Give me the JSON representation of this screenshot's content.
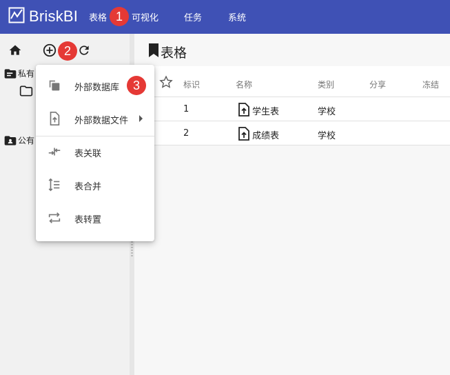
{
  "app": {
    "logo_text": "BriskBI"
  },
  "topnav": {
    "items": [
      {
        "label": "表格"
      },
      {
        "label": "可视化"
      },
      {
        "label": "任务"
      },
      {
        "label": "系统"
      }
    ]
  },
  "annotations": {
    "badge1": "1",
    "badge2": "2",
    "badge3": "3"
  },
  "sidebar": {
    "toolbar": {
      "home_icon": "home-icon",
      "add_icon": "add-circle-icon",
      "refresh_icon": "refresh-icon"
    },
    "tree": [
      {
        "label": "私有",
        "icon": "private-folder-icon"
      },
      {
        "label": "公有",
        "icon": "public-folder-icon"
      }
    ]
  },
  "main": {
    "title": "表格",
    "table": {
      "headers": [
        "标识",
        "名称",
        "类别",
        "分享",
        "冻结"
      ],
      "rows": [
        {
          "id": "1",
          "name": "学生表",
          "category": "学校"
        },
        {
          "id": "2",
          "name": "成绩表",
          "category": "学校"
        }
      ]
    }
  },
  "menu": {
    "items": [
      {
        "label": "外部数据库",
        "icon": "copy-database-icon"
      },
      {
        "label": "外部数据文件",
        "icon": "file-upload-icon",
        "has_submenu": true
      },
      {
        "label": "表关联",
        "icon": "merge-arrows-icon"
      },
      {
        "label": "表合并",
        "icon": "vertical-arrows-icon"
      },
      {
        "label": "表转置",
        "icon": "swap-arrows-icon"
      }
    ]
  },
  "colors": {
    "topbar": "#3f51b5",
    "badge": "#e53935"
  }
}
